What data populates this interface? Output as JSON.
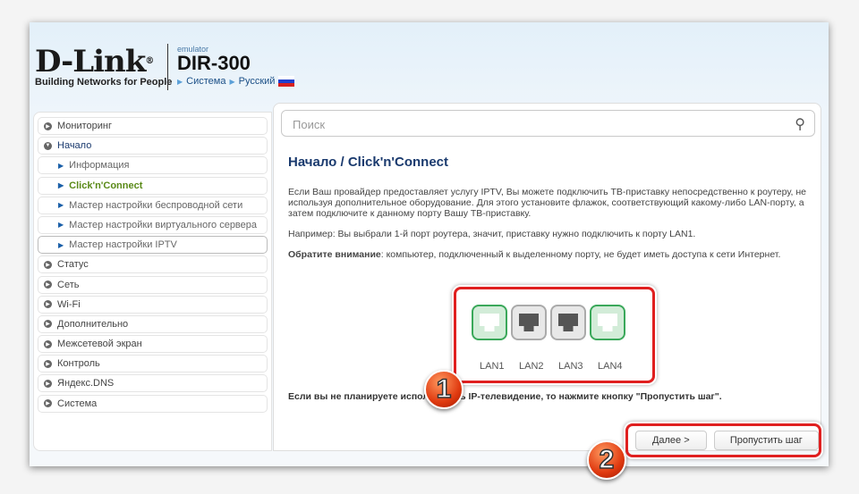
{
  "header": {
    "brand": "D-Link",
    "tagline": "Building Networks for People",
    "emulator": "emulator",
    "model": "DIR-300",
    "link_system": "Система",
    "link_language": "Русский"
  },
  "sidebar": {
    "items": [
      {
        "label": "Мониторинг",
        "type": "group"
      },
      {
        "label": "Начало",
        "type": "open"
      },
      {
        "label": "Информация",
        "type": "sub"
      },
      {
        "label": "Click'n'Connect",
        "type": "current"
      },
      {
        "label": "Мастер настройки беспроводной сети",
        "type": "sub"
      },
      {
        "label": "Мастер настройки виртуального сервера",
        "type": "sub"
      },
      {
        "label": "Мастер настройки IPTV",
        "type": "selected"
      },
      {
        "label": "Статус",
        "type": "group"
      },
      {
        "label": "Сеть",
        "type": "group"
      },
      {
        "label": "Wi-Fi",
        "type": "group"
      },
      {
        "label": "Дополнительно",
        "type": "group"
      },
      {
        "label": "Межсетевой экран",
        "type": "group"
      },
      {
        "label": "Контроль",
        "type": "group"
      },
      {
        "label": "Яндекс.DNS",
        "type": "group"
      },
      {
        "label": "Система",
        "type": "group"
      }
    ]
  },
  "search": {
    "placeholder": "Поиск"
  },
  "main": {
    "title": "Начало /  Click'n'Connect",
    "p1": "Если Ваш провайдер предоставляет услугу IPTV, Вы можете подключить ТВ-приставку непосредственно к роутеру, не используя дополнительное оборудование. Для этого установите флажок, соответствующий какому-либо LAN-порту, а затем подключите к данному порту Вашу ТВ-приставку.",
    "p2": "Например: Вы выбрали 1-й порт роутера, значит, приставку нужно подключить к порту LAN1.",
    "p3_bold": "Обратите внимание",
    "p3": ": компьютер, подключенный к выделенному порту, не будет иметь доступа к сети Интернет.",
    "ports": [
      {
        "label": "LAN1",
        "selected": true
      },
      {
        "label": "LAN2",
        "selected": false
      },
      {
        "label": "LAN3",
        "selected": false
      },
      {
        "label": "LAN4",
        "selected": true
      }
    ],
    "bottom_note": "Если вы не планируете использовать IP-телевидение, то нажмите кнопку \"Пропустить шаг\".",
    "next_button": "Далее >",
    "skip_button": "Пропустить шаг"
  },
  "annotations": {
    "badge1": "1",
    "badge2": "2"
  },
  "colors": {
    "highlight": "#e02020",
    "title": "#1a3a6e",
    "current": "#5a8a18"
  }
}
